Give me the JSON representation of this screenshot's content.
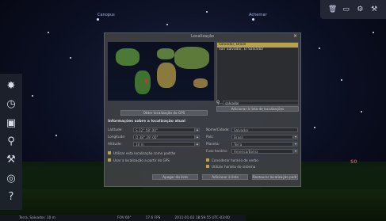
{
  "sky": {
    "star_labels": [
      "Canopus",
      "Achernar"
    ]
  },
  "topbar": {
    "icons": [
      "trash-icon",
      "window-icon",
      "gear-icon",
      "wrench-icon"
    ]
  },
  "leftbar": {
    "icons": [
      "sun-icon",
      "clock-icon",
      "camera-icon",
      "search-icon",
      "wrench-icon",
      "compass-icon",
      "help-icon"
    ]
  },
  "bottombar": {
    "location": "Terra, Salvador, 10 m",
    "fov": "FOV 60°",
    "fps": "17.6 FPS",
    "datetime": "2011-01-02 18:59:55 UTC-03:00"
  },
  "overlay_marker": "S0",
  "dialog": {
    "title": "Localização",
    "close": "×",
    "locations": [
      "Salvador, Brazil",
      "San Salvador, El Salvador"
    ],
    "selected_index": 0,
    "search_value": "salvador",
    "add_list_button": "Adicionar à lista de localizações",
    "map_button": "Obter localização do GPS",
    "section_title": "Informações sobre a localização atual",
    "latitude_label": "Latitude:",
    "latitude_value": "S 12° 58' 00\"",
    "longitude_label": "Longitude:",
    "longitude_value": "O 38° 29' 00\"",
    "altitude_label": "Altitude:",
    "altitude_value": "10 m",
    "name_label": "Nome/Cidade:",
    "name_value": "Salvador",
    "country_label": "País:",
    "country_value": "Brasil",
    "planet_label": "Planeta:",
    "planet_value": "Terra",
    "region_label": "Fuso horário:",
    "region_value": "America/Bahia",
    "check_default": "Utilizar esta localização como padrão",
    "check_gps": "Usar a localização a partir do GPS",
    "check_dst": "Considerar horário de verão",
    "check_time": "Utilizar horário do sistema",
    "delete_button": "Apagar da lista",
    "add_button": "Adicionar à lista",
    "reset_button": "Restaurar localização padrão",
    "accent": "#b8a24a",
    "pin_color": "#ee2233"
  }
}
